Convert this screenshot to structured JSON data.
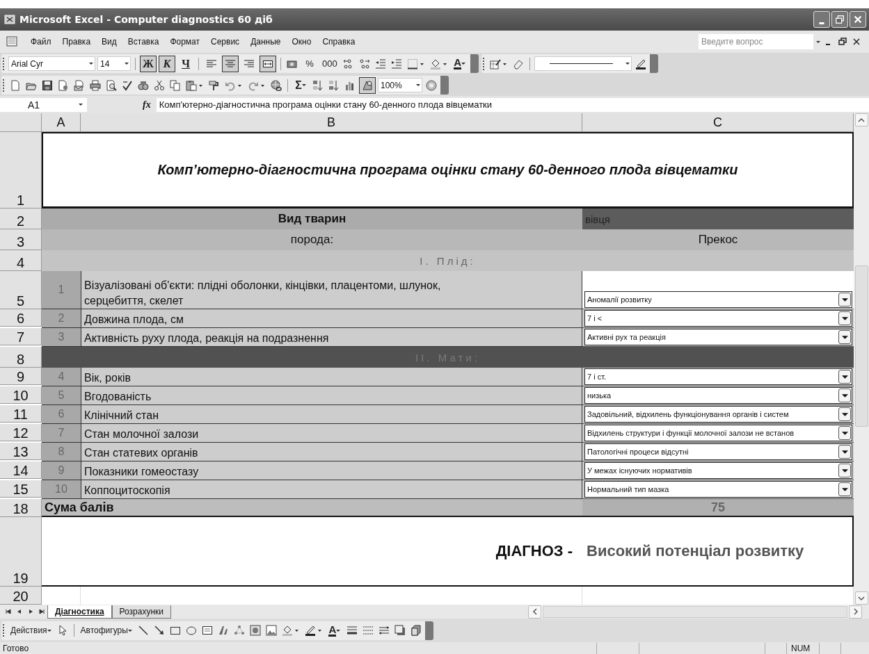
{
  "window": {
    "title": "Microsoft Excel - Computer diagnostics 60 діб"
  },
  "menu": [
    "Файл",
    "Правка",
    "Вид",
    "Вставка",
    "Формат",
    "Сервис",
    "Данные",
    "Окно",
    "Справка"
  ],
  "help_search": {
    "placeholder": "Введите вопрос"
  },
  "format_toolbar": {
    "font": "Arial Cyr",
    "size": "14",
    "styles": [
      {
        "label": "Ж",
        "selected": true
      },
      {
        "label": "К",
        "selected": true
      },
      {
        "label": "Ч",
        "selected": false
      }
    ],
    "alignment": [
      {
        "kind": "left",
        "selected": false
      },
      {
        "kind": "center",
        "selected": true
      },
      {
        "kind": "right",
        "selected": false
      },
      {
        "kind": "merge",
        "selected": true
      }
    ],
    "percent": "%",
    "thousands": "000",
    "font_color": "A"
  },
  "standard_toolbar": {
    "sum": "Σ",
    "drawing": {
      "selected": true
    },
    "zoom": "100%"
  },
  "formula_bar": {
    "cell": "A1",
    "fx": "fx",
    "content": "Комп'ютерно-діагностична програма оцінки стану 60-денного плода вівцематки"
  },
  "columns": [
    "A",
    "B",
    "C"
  ],
  "rows": [
    {
      "num": "1",
      "kind": "title",
      "text": "Комп’ютерно-діагностична програма оцінки стану 60-денного плода вівцематки"
    },
    {
      "num": "2",
      "kind": "species",
      "label": "Вид тварин",
      "value": "вівця"
    },
    {
      "num": "3",
      "kind": "breed",
      "label": "порода:",
      "value": "Прекос"
    },
    {
      "num": "4",
      "kind": "section",
      "text": "І. Плід:",
      "color": "#c4c4c4"
    },
    {
      "num": "5",
      "kind": "item",
      "index": "1",
      "text": "Візуалізовані об'єкти: плідні оболонки, кінцівки, плацентоми, шлунок, серцебиття, скелет",
      "value": "Аномалії розвитку"
    },
    {
      "num": "6",
      "kind": "item",
      "index": "2",
      "text": "Довжина плода, см",
      "value": "7 і <"
    },
    {
      "num": "7",
      "kind": "item",
      "index": "3",
      "text": "Активність руху плода, реакція на подразнення",
      "value": "Активні рух та реакція"
    },
    {
      "num": "8",
      "kind": "section",
      "text": "ІІ. Мати:",
      "color": "#515151"
    },
    {
      "num": "9",
      "kind": "item",
      "index": "4",
      "text": "Вік, років",
      "value": "7 і ст."
    },
    {
      "num": "10",
      "kind": "item",
      "index": "5",
      "text": "Вгодованість",
      "value": "низька"
    },
    {
      "num": "11",
      "kind": "item",
      "index": "6",
      "text": "Клінічний стан",
      "value": "Задовільний, відхилень функціонування органів і систем"
    },
    {
      "num": "12",
      "kind": "item",
      "index": "7",
      "text": "Стан молочної залози",
      "value": "Відхилень структури і функції молочної залози не встанов"
    },
    {
      "num": "13",
      "kind": "item",
      "index": "8",
      "text": "Стан статевих органів",
      "value": "Патологічні процеси відсутні"
    },
    {
      "num": "14",
      "kind": "item",
      "index": "9",
      "text": "Показники гомеостазу",
      "value": "У межах існуючих нормативів"
    },
    {
      "num": "15",
      "kind": "item",
      "index": "10",
      "text": "Коппоцитоскопія",
      "value": "Нормальний тип мазка"
    },
    {
      "num": "18",
      "kind": "total",
      "heading": "Сума балів",
      "value": "75"
    },
    {
      "num": "19",
      "kind": "diagnosis",
      "label": "ДІАГНОЗ -",
      "value": "Високий потенціал розвитку"
    },
    {
      "num": "20",
      "kind": "empty"
    }
  ],
  "sheet_tabs": [
    {
      "label": "Діагностика",
      "selected": true
    },
    {
      "label": "Розрахунки",
      "selected": false
    }
  ],
  "drawing_toolbar": {
    "actions": "Действия",
    "autoshapes": "Автофигуры",
    "font_color": "A"
  },
  "status_bar": {
    "text": "Готово",
    "indicators": [
      "NUM"
    ]
  }
}
